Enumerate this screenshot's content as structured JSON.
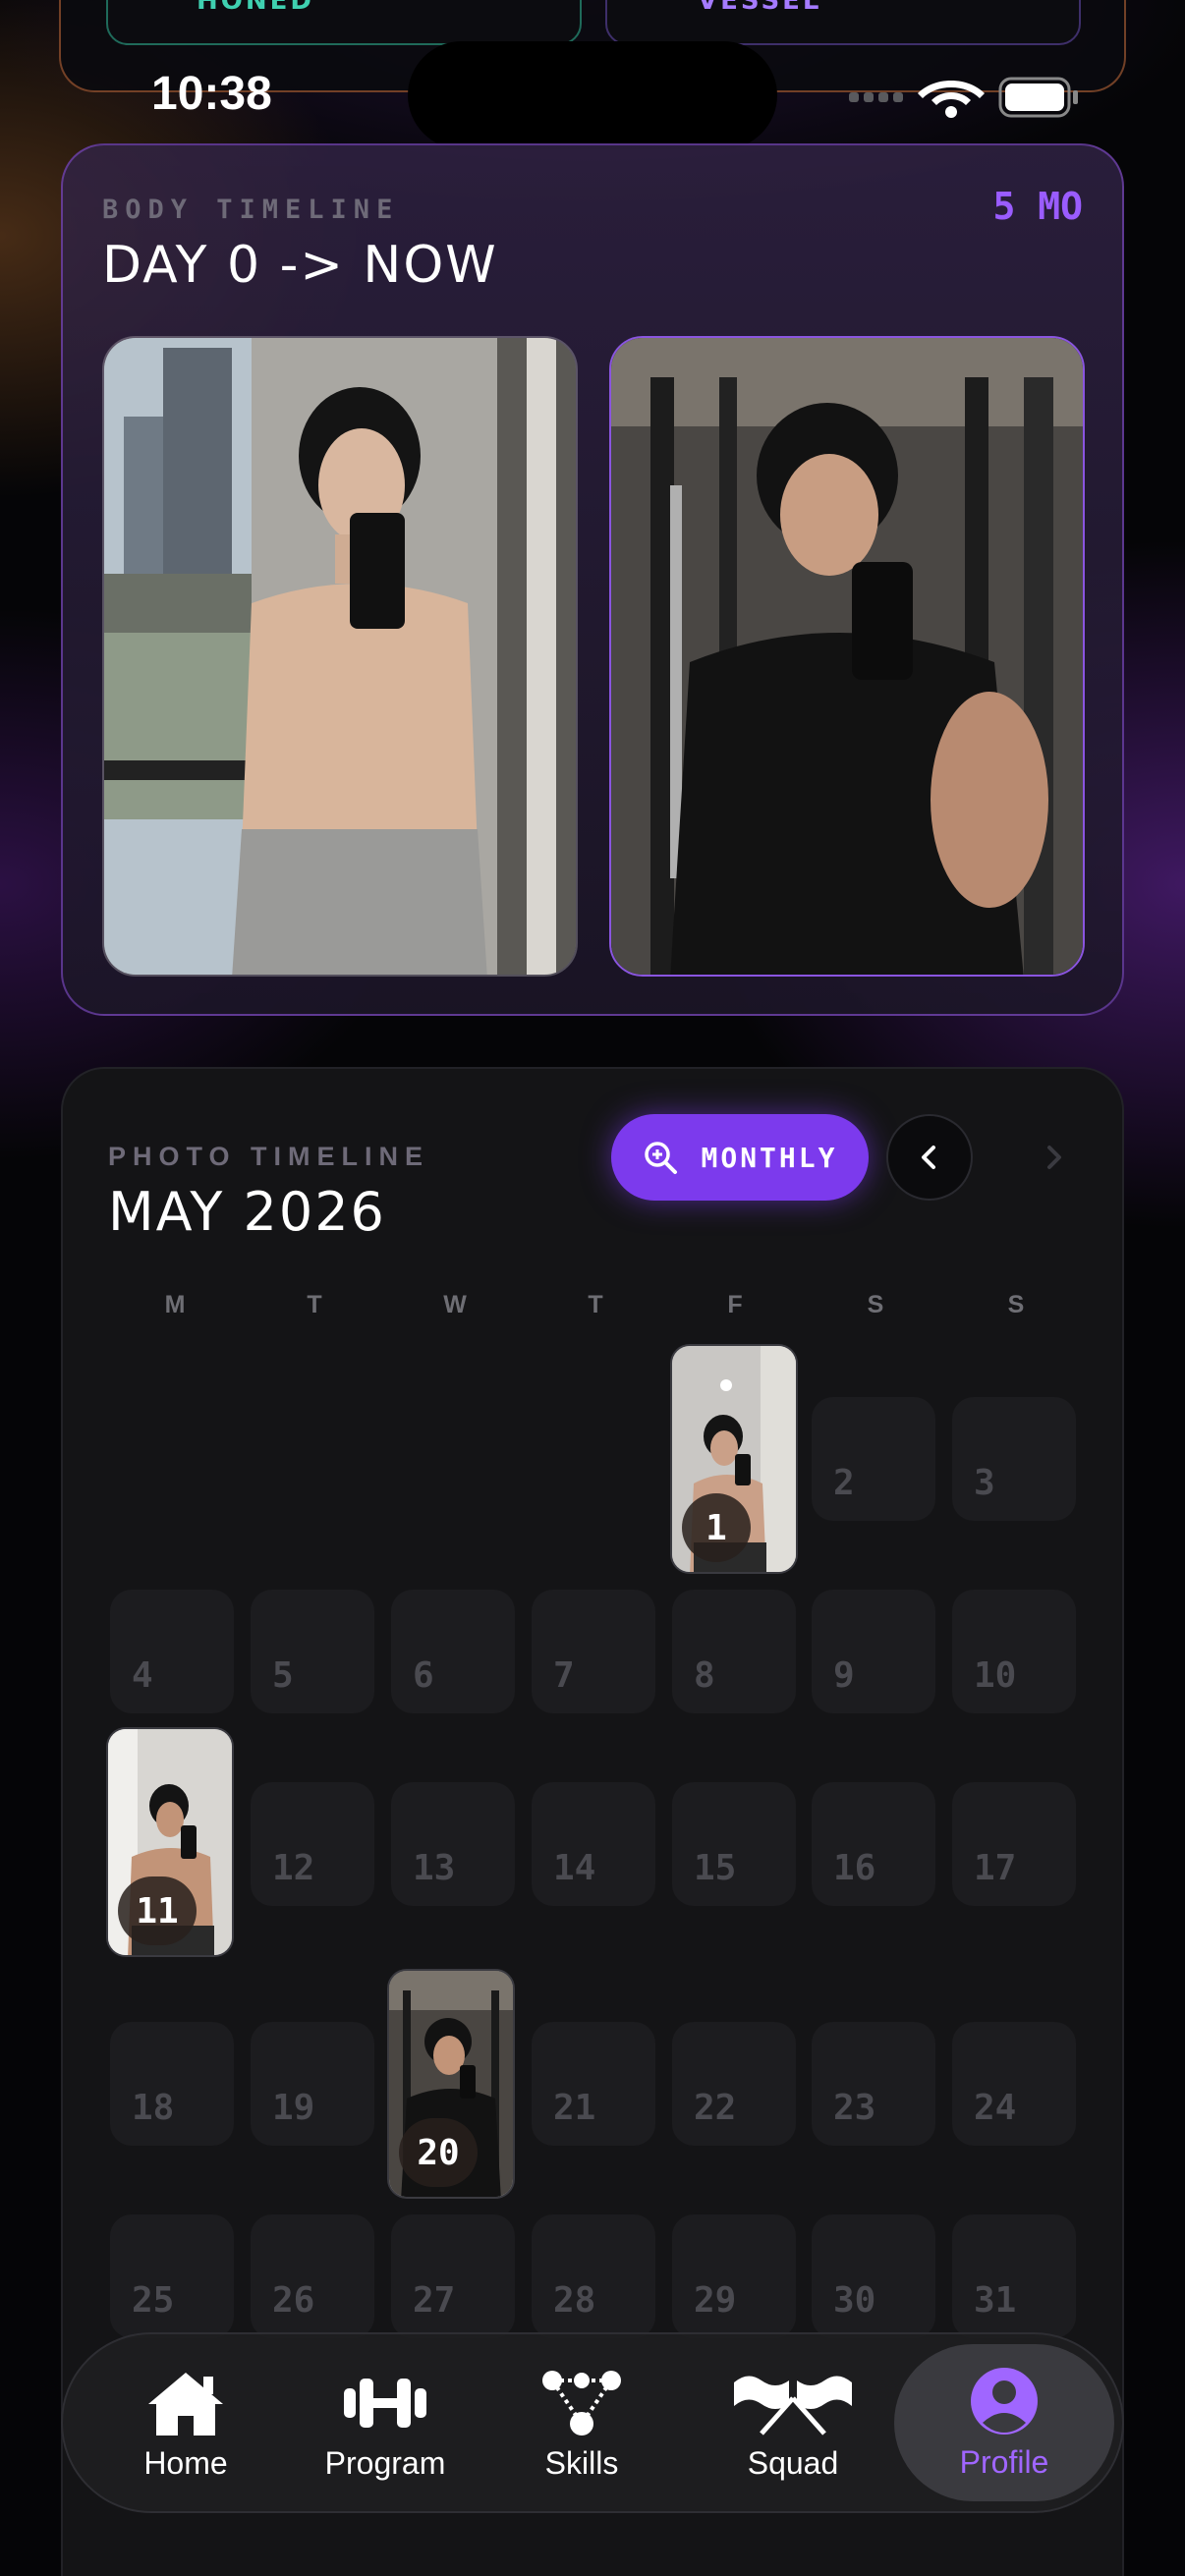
{
  "status_bar": {
    "time": "10:38"
  },
  "top_peek": {
    "left_label": "HONED",
    "right_label": "VESSEL"
  },
  "body_timeline": {
    "label": "BODY TIMELINE",
    "title": "DAY 0 -> NOW",
    "period": "5 MO"
  },
  "photo_timeline": {
    "label": "PHOTO TIMELINE",
    "title": "MAY 2026",
    "view_mode": "MONTHLY",
    "weekdays": [
      "M",
      "T",
      "W",
      "T",
      "F",
      "S",
      "S"
    ],
    "photo_days": [
      1,
      11,
      20
    ],
    "days": [
      "1",
      "2",
      "3",
      "4",
      "5",
      "6",
      "7",
      "8",
      "9",
      "10",
      "11",
      "12",
      "13",
      "14",
      "15",
      "16",
      "17",
      "18",
      "19",
      "20",
      "21",
      "22",
      "23",
      "24",
      "25",
      "26",
      "27",
      "28",
      "29",
      "30",
      "31"
    ]
  },
  "tabbar": {
    "items": [
      {
        "label": "Home",
        "icon": "home-icon"
      },
      {
        "label": "Program",
        "icon": "dumbbell-icon"
      },
      {
        "label": "Skills",
        "icon": "skill-tree-icon"
      },
      {
        "label": "Squad",
        "icon": "flags-icon"
      },
      {
        "label": "Profile",
        "icon": "profile-icon"
      }
    ],
    "active": "Profile"
  },
  "colors": {
    "accent": "#7c3aed",
    "accent_text": "#9a5cff",
    "active_tab": "#a066ff"
  }
}
